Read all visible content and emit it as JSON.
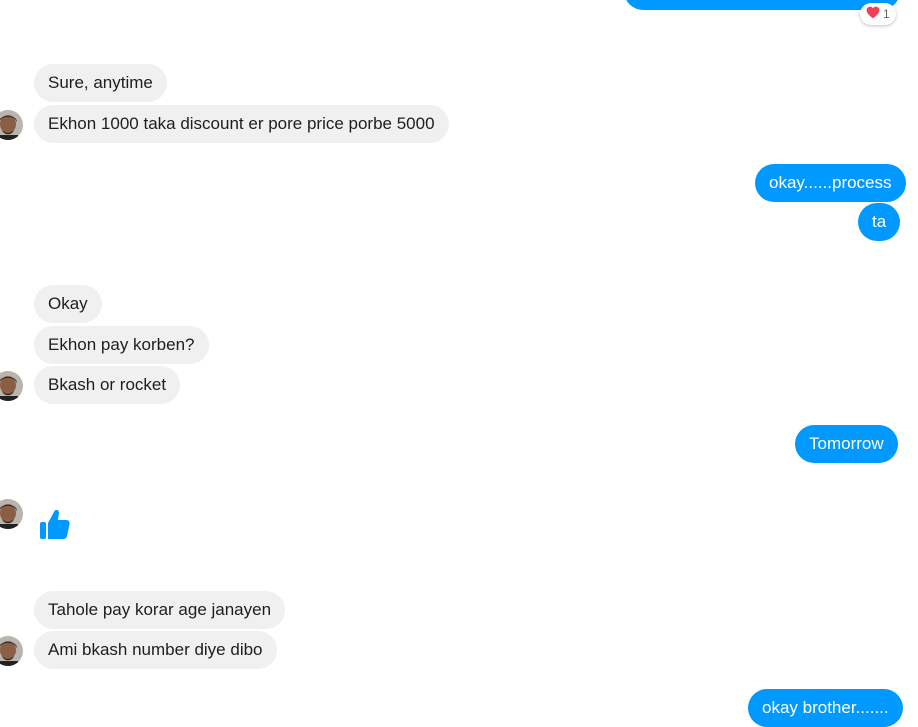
{
  "messages": [
    {
      "text": "Sure, anytime"
    },
    {
      "text": "Ekhon 1000 taka discount er pore price porbe 5000"
    },
    {
      "text": "okay......process"
    },
    {
      "text": "ta"
    },
    {
      "text": "Okay"
    },
    {
      "text": "Ekhon pay korben?"
    },
    {
      "text": "Bkash or rocket"
    },
    {
      "text": "Tomorrow"
    },
    {
      "text": "Tahole pay korar age janayen"
    },
    {
      "text": "Ami bkash number diye dibo"
    },
    {
      "text": "okay brother......."
    }
  ],
  "reaction": {
    "icon": "heart-icon",
    "count": "1"
  },
  "thumbs_up": {
    "icon": "thumbs-up-icon"
  },
  "colors": {
    "outgoing": "#0099ff",
    "incoming": "#f0f0f0",
    "reaction_heart": "#f33e58"
  }
}
